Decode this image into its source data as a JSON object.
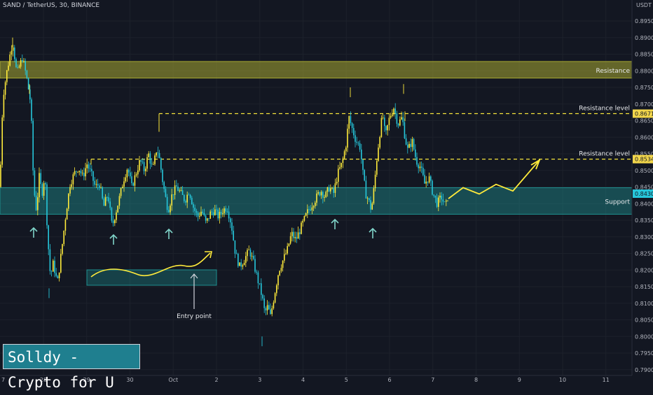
{
  "header": {
    "symbol": "SAND / TetherUS",
    "interval": "30",
    "exchange": "BINANCE",
    "currency": "USDT"
  },
  "brand": "Solldy - Crypto for U",
  "colors": {
    "background": "#131722",
    "up": "#ffeb3b",
    "down": "#26c6da",
    "resistance_zone": "#a8a832",
    "support_zone": "#1e8f8f",
    "dashed": "#f5e33b",
    "arrow": "#7fd3c8"
  },
  "chart_data": {
    "type": "candlestick",
    "title": "",
    "ylim": [
      0.7889,
      0.9012
    ],
    "y_ticks": [
      "0.8950",
      "0.8900",
      "0.8850",
      "0.8800",
      "0.8750",
      "0.8700",
      "0.8650",
      "0.8600",
      "0.8550",
      "0.8500",
      "0.8450",
      "0.8400",
      "0.8350",
      "0.8300",
      "0.8250",
      "0.8200",
      "0.8150",
      "0.8100",
      "0.8050",
      "0.8000",
      "0.7950",
      "0.7900"
    ],
    "x_ticks": [
      "28",
      "29",
      "30",
      "Oct",
      "2",
      "3",
      "4",
      "5",
      "6",
      "7",
      "8",
      "9",
      "10",
      "11"
    ],
    "price_labels": [
      {
        "label": "0.8671",
        "value": 0.8671
      },
      {
        "label": "0.8534",
        "value": 0.8534
      },
      {
        "label": "0.8430",
        "value": 0.843
      }
    ],
    "zones": [
      {
        "name": "Resistance",
        "y_from": 0.8778,
        "y_to": 0.8828
      },
      {
        "name": "Support",
        "y_from": 0.8368,
        "y_to": 0.8448
      }
    ],
    "levels": [
      {
        "name": "Resistance level",
        "value": 0.8671
      },
      {
        "name": "Resistance level",
        "value": 0.8534
      }
    ],
    "annotation": "Entry point",
    "price_path": [
      [
        0,
        0.845
      ],
      [
        4,
        0.872
      ],
      [
        10,
        0.88
      ],
      [
        18,
        0.889
      ],
      [
        24,
        0.879
      ],
      [
        32,
        0.884
      ],
      [
        38,
        0.878
      ],
      [
        44,
        0.87
      ],
      [
        48,
        0.845
      ],
      [
        52,
        0.838
      ],
      [
        56,
        0.848
      ],
      [
        60,
        0.843
      ],
      [
        64,
        0.849
      ],
      [
        68,
        0.83
      ],
      [
        72,
        0.818
      ],
      [
        76,
        0.822
      ],
      [
        82,
        0.816
      ],
      [
        88,
        0.826
      ],
      [
        94,
        0.837
      ],
      [
        100,
        0.846
      ],
      [
        106,
        0.849
      ],
      [
        112,
        0.851
      ],
      [
        118,
        0.848
      ],
      [
        124,
        0.852
      ],
      [
        130,
        0.849
      ],
      [
        136,
        0.845
      ],
      [
        142,
        0.846
      ],
      [
        148,
        0.839
      ],
      [
        154,
        0.843
      ],
      [
        160,
        0.833
      ],
      [
        166,
        0.838
      ],
      [
        172,
        0.843
      ],
      [
        176,
        0.847
      ],
      [
        182,
        0.851
      ],
      [
        188,
        0.845
      ],
      [
        194,
        0.849
      ],
      [
        200,
        0.853
      ],
      [
        206,
        0.85
      ],
      [
        212,
        0.855
      ],
      [
        218,
        0.85
      ],
      [
        224,
        0.857
      ],
      [
        228,
        0.853
      ],
      [
        232,
        0.847
      ],
      [
        236,
        0.842
      ],
      [
        240,
        0.838
      ],
      [
        246,
        0.843
      ],
      [
        252,
        0.845
      ],
      [
        258,
        0.843
      ],
      [
        264,
        0.841
      ],
      [
        270,
        0.844
      ],
      [
        276,
        0.839
      ],
      [
        282,
        0.836
      ],
      [
        288,
        0.838
      ],
      [
        294,
        0.834
      ],
      [
        300,
        0.837
      ],
      [
        306,
        0.838
      ],
      [
        312,
        0.836
      ],
      [
        318,
        0.838
      ],
      [
        324,
        0.839
      ],
      [
        330,
        0.834
      ],
      [
        336,
        0.825
      ],
      [
        342,
        0.821
      ],
      [
        348,
        0.823
      ],
      [
        356,
        0.826
      ],
      [
        362,
        0.822
      ],
      [
        368,
        0.817
      ],
      [
        374,
        0.812
      ],
      [
        378,
        0.807
      ],
      [
        382,
        0.809
      ],
      [
        386,
        0.806
      ],
      [
        392,
        0.813
      ],
      [
        398,
        0.82
      ],
      [
        404,
        0.823
      ],
      [
        410,
        0.826
      ],
      [
        416,
        0.831
      ],
      [
        422,
        0.829
      ],
      [
        428,
        0.832
      ],
      [
        434,
        0.835
      ],
      [
        440,
        0.838
      ],
      [
        446,
        0.84
      ],
      [
        452,
        0.842
      ],
      [
        458,
        0.844
      ],
      [
        464,
        0.842
      ],
      [
        470,
        0.845
      ],
      [
        476,
        0.843
      ],
      [
        482,
        0.849
      ],
      [
        488,
        0.852
      ],
      [
        494,
        0.858
      ],
      [
        498,
        0.866
      ],
      [
        502,
        0.863
      ],
      [
        508,
        0.859
      ],
      [
        514,
        0.857
      ],
      [
        518,
        0.849
      ],
      [
        522,
        0.843
      ],
      [
        526,
        0.841
      ],
      [
        530,
        0.838
      ],
      [
        534,
        0.845
      ],
      [
        538,
        0.854
      ],
      [
        542,
        0.861
      ],
      [
        546,
        0.867
      ],
      [
        550,
        0.86
      ],
      [
        556,
        0.866
      ],
      [
        562,
        0.869
      ],
      [
        568,
        0.864
      ],
      [
        574,
        0.866
      ],
      [
        578,
        0.86
      ],
      [
        582,
        0.856
      ],
      [
        588,
        0.859
      ],
      [
        594,
        0.853
      ],
      [
        600,
        0.851
      ],
      [
        606,
        0.846
      ],
      [
        612,
        0.848
      ],
      [
        618,
        0.843
      ],
      [
        624,
        0.84
      ],
      [
        630,
        0.842
      ],
      [
        636,
        0.839
      ],
      [
        640,
        0.843
      ]
    ],
    "projection": [
      [
        640,
        0.8415
      ],
      [
        661,
        0.8448
      ],
      [
        684,
        0.8429
      ],
      [
        708,
        0.8458
      ],
      [
        732,
        0.8438
      ],
      [
        770,
        0.8531
      ]
    ]
  }
}
